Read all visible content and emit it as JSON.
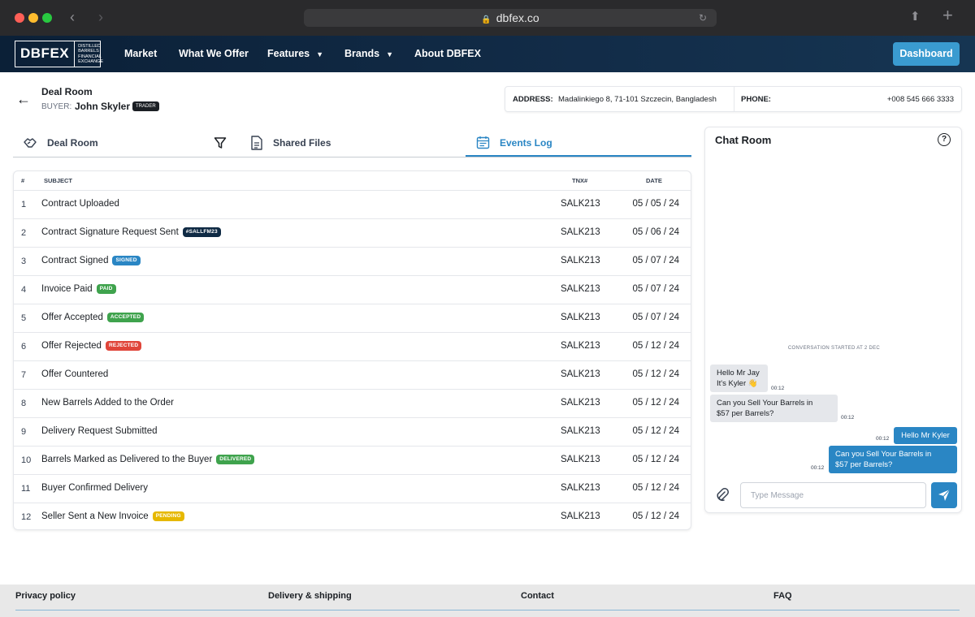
{
  "browser": {
    "url": "dbfex.co"
  },
  "nav": {
    "logo_text": "DBFEX",
    "logo_sub": "DISTILLED BARRELS FINANCIAL EXCHANGE",
    "items": [
      {
        "label": "Market"
      },
      {
        "label": "What We Offer"
      },
      {
        "label": "Features",
        "dropdown": true
      },
      {
        "label": "Brands",
        "dropdown": true
      },
      {
        "label": "About DBFEX"
      }
    ],
    "dashboard_label": "Dashboard"
  },
  "header": {
    "title": "Deal Room",
    "buyer_label": "BUYER:",
    "buyer_name": "John Skyler",
    "buyer_badge": "TRADER",
    "address_label": "ADDRESS:",
    "address_value": "Madalinkiego 8, 71-101 Szczecin, Bangladesh",
    "phone_label": "PHONE:",
    "phone_value": "+008 545 666 3333"
  },
  "tabs": [
    {
      "label": "Deal Room",
      "icon": "handshake-icon"
    },
    {
      "label": "",
      "icon": "filter-icon"
    },
    {
      "label": "Shared Files",
      "icon": "file-icon"
    },
    {
      "label": "Events Log",
      "icon": "calendar-icon",
      "active": true
    }
  ],
  "table": {
    "columns": [
      "#",
      "SUBJECT",
      "TNX#",
      "DATE"
    ],
    "rows": [
      {
        "num": "1",
        "subject": "Contract Uploaded",
        "badge": "",
        "tnx": "SALK213",
        "date": "05 / 05 / 24"
      },
      {
        "num": "2",
        "subject": "Contract Signature Request Sent",
        "badge": "#SALLFM23",
        "badge_color": "#0f2a44",
        "tnx": "SALK213",
        "date": "05 / 06 / 24"
      },
      {
        "num": "3",
        "subject": "Contract Signed",
        "badge": "SIGNED",
        "badge_color": "#2a86c4",
        "tnx": "SALK213",
        "date": "05 / 07 / 24"
      },
      {
        "num": "4",
        "subject": "Invoice Paid",
        "badge": "PAID",
        "badge_color": "#3fa34d",
        "tnx": "SALK213",
        "date": "05 / 07 / 24"
      },
      {
        "num": "5",
        "subject": "Offer Accepted",
        "badge": "ACCEPTED",
        "badge_color": "#3fa34d",
        "tnx": "SALK213",
        "date": "05 / 07 / 24"
      },
      {
        "num": "6",
        "subject": "Offer Rejected",
        "badge": "REJECTED",
        "badge_color": "#e0453a",
        "tnx": "SALK213",
        "date": "05 / 12 / 24"
      },
      {
        "num": "7",
        "subject": "Offer Countered",
        "badge": "",
        "tnx": "SALK213",
        "date": "05 / 12 / 24"
      },
      {
        "num": "8",
        "subject": "New Barrels Added to the Order",
        "badge": "",
        "tnx": "SALK213",
        "date": "05 / 12 / 24"
      },
      {
        "num": "9",
        "subject": "Delivery Request Submitted",
        "badge": "",
        "tnx": "SALK213",
        "date": "05 / 12 / 24"
      },
      {
        "num": "10",
        "subject": "Barrels Marked as Delivered to the Buyer",
        "badge": "DELIVERED",
        "badge_color": "#3fa34d",
        "tnx": "SALK213",
        "date": "05 / 12 / 24"
      },
      {
        "num": "11",
        "subject": "Buyer Confirmed Delivery",
        "badge": "",
        "tnx": "SALK213",
        "date": "05 / 12 / 24"
      },
      {
        "num": "12",
        "subject": "Seller Sent a New Invoice",
        "badge": "PENDING",
        "badge_color": "#e6b800",
        "tnx": "SALK213",
        "date": "05 / 12 / 24"
      }
    ]
  },
  "chat": {
    "title": "Chat Room",
    "conversation_started": "CONVERSATION STARTED AT 2 DEC",
    "messages": [
      {
        "dir": "in",
        "text1": "Hello Mr Jay",
        "text2": "It's Kyler 👋",
        "time": "00:12"
      },
      {
        "dir": "in",
        "text1": "Can you Sell Your Barrels in",
        "text2": "$57 per Barrels?",
        "time": "00:12"
      },
      {
        "dir": "out",
        "text1": "Hello Mr Kyler",
        "text2": "",
        "time": "00:12"
      },
      {
        "dir": "out",
        "text1": "Can you Sell Your Barrels in",
        "text2": "$57 per Barrels?",
        "time": "00:12"
      }
    ],
    "input_placeholder": "Type Message"
  },
  "footer": {
    "links": [
      "Privacy policy",
      "Delivery & shipping",
      "Contact",
      "FAQ"
    ]
  },
  "colors": {
    "accent": "#2a86c4",
    "nav_bg": "#0b2037",
    "dashboard_btn": "#3a9bd0"
  }
}
